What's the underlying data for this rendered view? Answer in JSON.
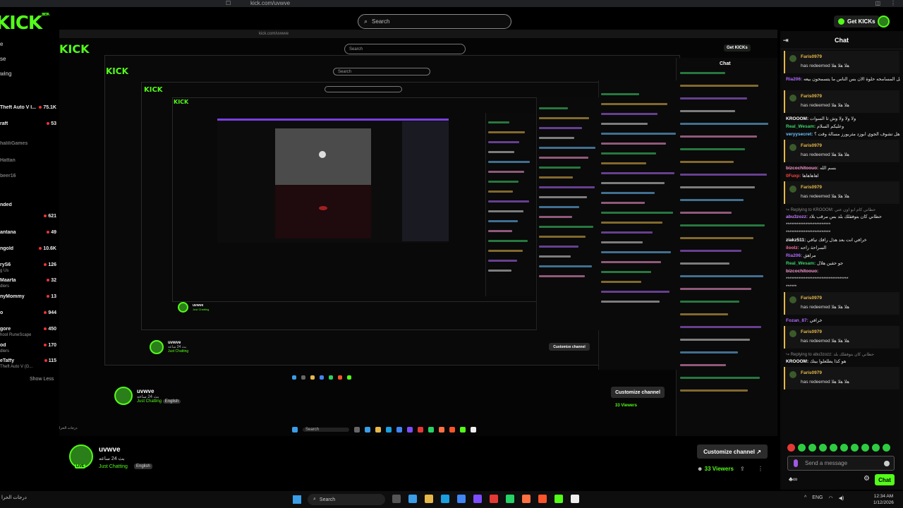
{
  "browser": {
    "url": "kick.com/uvwve"
  },
  "header": {
    "logo": "KICK",
    "logo_badge": "BETA",
    "search_placeholder": "Search",
    "get_kicks_label": "Get KICKs"
  },
  "sidebar": {
    "nav": [
      "e",
      "se",
      "wing"
    ],
    "channels": [
      {
        "name": "Theft Auto V I...",
        "count": "75.1K"
      },
      {
        "name": "raft",
        "count": "53"
      },
      {
        "name": "haliliGames",
        "count": ""
      },
      {
        "name": "Hattan",
        "count": ""
      },
      {
        "name": "beer16",
        "count": ""
      },
      {
        "name": "nded",
        "count": ""
      },
      {
        "name": "",
        "count": "621"
      },
      {
        "name": "antana",
        "count": "49"
      },
      {
        "name": "ngold",
        "count": "10.6K"
      },
      {
        "name": "ryS6",
        "count": "126"
      },
      {
        "name": "Maarta",
        "count": "32"
      },
      {
        "name": "nyMommy",
        "count": "13"
      },
      {
        "name": "o",
        "count": "944"
      },
      {
        "name": "gore",
        "count": "450"
      },
      {
        "name": "od",
        "count": "170"
      },
      {
        "name": "eTaffy",
        "count": "115"
      }
    ],
    "subs": [
      "g Us",
      "dlers",
      "hool RuneScape",
      "dlers",
      "Theft Auto V (G..."
    ],
    "show_less": "Show Less"
  },
  "stream": {
    "username": "uvwve",
    "title": "بث 24 ساعه",
    "category": "Just Chatting",
    "language": "English",
    "live_badge": "LIVE",
    "customize_label": "Customize channel",
    "viewers_count": "33",
    "viewers_label": "Viewers"
  },
  "mirror": {
    "url": "kick.com/uvwve",
    "search": "Search",
    "get_kicks": "Get KICKs",
    "chat_title": "Chat",
    "username": "uvwve",
    "title": "بث 24 ساعه",
    "category": "Just Chatting",
    "language": "English",
    "customize": "Customize channel",
    "viewers": "33 Viewers",
    "taskbar_search": "Search",
    "weather": "درجات الحرا"
  },
  "chat": {
    "title": "Chat",
    "input_placeholder": "Send a message",
    "send_label": "Chat",
    "messages": [
      {
        "type": "redeem",
        "user": "Faris0979",
        "text": "has redeemed هلا هلا هلا"
      },
      {
        "type": "msg",
        "user": "Ria206:",
        "user_color": "#b36bff",
        "text": " لا والله بتون اللي يتحامل المسامحه حلوة الآن بس الناس ما يتسمحون بيعه"
      },
      {
        "type": "redeem",
        "user": "Faris0979",
        "text": "has redeemed هلا هلا هلا"
      },
      {
        "type": "msg",
        "user": "KROOOM:",
        "user_color": "#ffffff",
        "text": " ولا ولا ولا وش ثا السوات"
      },
      {
        "type": "msg",
        "user": "Real_Wesam:",
        "user_color": "#3fd16b",
        "text": " وعليكم السلام"
      },
      {
        "type": "msg",
        "user": "veryysecret:",
        "user_color": "#6fc3ff",
        "text": " هل تشوف الجوي ابوزد مثربورز مسالة وقت ؟"
      },
      {
        "type": "redeem",
        "user": "Faris0979",
        "text": "has redeemed هلا هلا هلا"
      },
      {
        "type": "msg",
        "user": "bizcochitoouo:",
        "user_color": "#ff9ad5",
        "text": " بسم الله"
      },
      {
        "type": "msg",
        "user": "0Fuxp:",
        "user_color": "#ff4444",
        "text": " اهاهاهاها"
      },
      {
        "type": "redeem",
        "user": "Faris0979",
        "text": "has redeemed هلا هلا هلا"
      },
      {
        "type": "reply",
        "text": "↪ Replying to KROOOM: حطاني كام ابو اون عتي"
      },
      {
        "type": "msg",
        "user": "abu3zozz:",
        "user_color": "#c77dff",
        "text": " حطاني كان بتوفقلك بلد بس مرقب بلاد"
      },
      {
        "type": "msg",
        "user": "",
        "user_color": "#ffffff",
        "text": "*************************"
      },
      {
        "type": "msg",
        "user": "",
        "user_color": "#ffffff",
        "text": "*************************"
      },
      {
        "type": "msg",
        "user": "ziakz511:",
        "user_color": "#ffffff",
        "text": " خرافي انت بعد هذل رافك تياقي"
      },
      {
        "type": "msg",
        "user": "iloolz:",
        "user_color": "#ff6fa3",
        "text": " السراحة راحه"
      },
      {
        "type": "msg",
        "user": "Ria206:",
        "user_color": "#b36bff",
        "text": " مراهق"
      },
      {
        "type": "msg",
        "user": "Real_Wesam:",
        "user_color": "#3fd16b",
        "text": " جو حقين هلال"
      },
      {
        "type": "msg",
        "user": "bizcochitoouo:",
        "user_color": "#ff9ad5",
        "text": ""
      },
      {
        "type": "msg",
        "user": "",
        "user_color": "#ffffff",
        "text": "***********************************"
      },
      {
        "type": "msg",
        "user": "",
        "user_color": "#ffffff",
        "text": "******"
      },
      {
        "type": "redeem",
        "user": "Faris0979",
        "text": "has redeemed هلا هلا هلا"
      },
      {
        "type": "msg",
        "user": "Fozan_87:",
        "user_color": "#b36bff",
        "text": " خرافي"
      },
      {
        "type": "redeem",
        "user": "Faris0979",
        "text": "has redeemed هلا هلا هلا"
      },
      {
        "type": "reply",
        "text": "↪ Replying to abu3zozz: حطاني كان بتوفقلك بلد"
      },
      {
        "type": "msg",
        "user": "KROOOM:",
        "user_color": "#ffffff",
        "text": " هو كذا يطلعلوا بيتك"
      },
      {
        "type": "redeem",
        "user": "Faris0979",
        "text": "has redeemed هلا هلا هلا"
      }
    ]
  },
  "taskbar": {
    "weather": "درجات الحرا",
    "search": "Search",
    "time": "12:34 AM",
    "date": "1/12/2026",
    "lang": "ENG"
  },
  "colors": {
    "accent": "#53fc18",
    "redeem_border": "#e6b84a",
    "background": "#000000"
  }
}
